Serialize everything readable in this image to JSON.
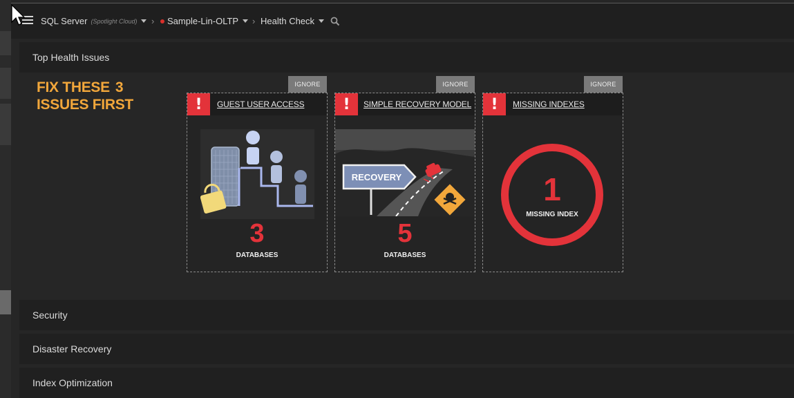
{
  "breadcrumb": {
    "server": "SQL Server",
    "server_sub": "(Spotlight Cloud)",
    "instance": "Sample-Lin-OLTP",
    "page": "Health Check"
  },
  "sections": {
    "top_health_issues": "Top Health Issues",
    "security": "Security",
    "disaster_recovery": "Disaster Recovery",
    "index_optimization": "Index Optimization"
  },
  "banner": {
    "line1": "FIX THESE",
    "count": "3",
    "line2": "ISSUES FIRST"
  },
  "cards": [
    {
      "ignore_label": "IGNORE",
      "title": "GUEST USER ACCESS",
      "count": "3",
      "unit": "DATABASES",
      "icon": "stairs-lock-illustration"
    },
    {
      "ignore_label": "IGNORE",
      "title": "SIMPLE RECOVERY MODEL",
      "count": "5",
      "unit": "DATABASES",
      "icon": "road-recovery-illustration",
      "sign_text": "RECOVERY"
    },
    {
      "ignore_label": "IGNORE",
      "title": "MISSING INDEXES",
      "count": "1",
      "unit": "MISSING INDEX",
      "icon": "ring-counter"
    }
  ],
  "colors": {
    "accent_red": "#e3333a",
    "banner_orange": "#f2a73b",
    "status_dot": "#d9302b"
  }
}
